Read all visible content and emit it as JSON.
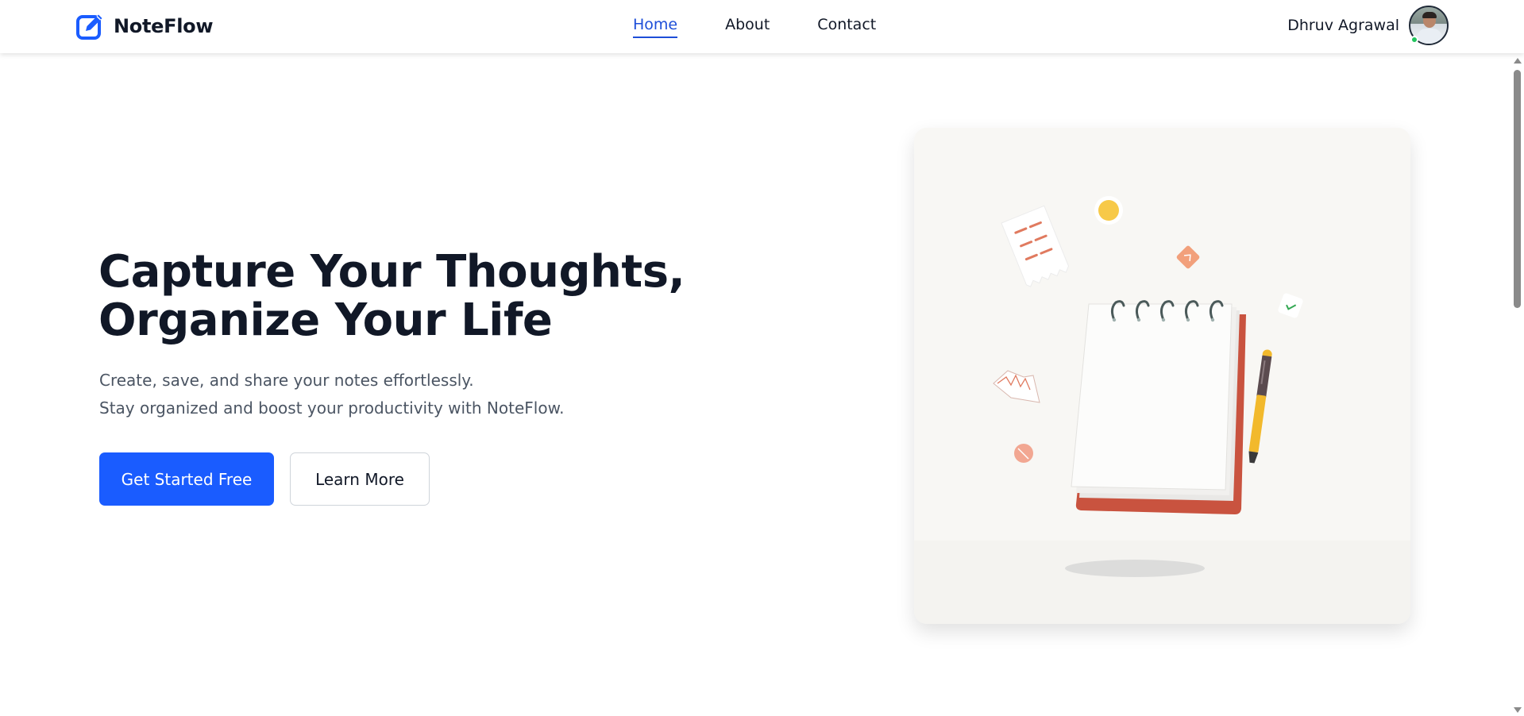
{
  "brand": {
    "name": "NoteFlow",
    "icon": "edit-note-icon"
  },
  "nav": {
    "links": [
      {
        "label": "Home",
        "active": true
      },
      {
        "label": "About",
        "active": false
      },
      {
        "label": "Contact",
        "active": false
      }
    ]
  },
  "user": {
    "name": "Dhruv Agrawal",
    "status": "online"
  },
  "hero": {
    "title_line1": "Capture Your Thoughts,",
    "title_line2": "Organize Your Life",
    "subtitle_line1": "Create, save, and share your notes effortlessly.",
    "subtitle_line2": "Stay organized and boost your productivity with NoteFlow.",
    "primary_cta": "Get Started Free",
    "secondary_cta": "Learn More"
  },
  "colors": {
    "accent": "#1a5cff",
    "active_link": "#1d4ed8",
    "heading": "#111827",
    "body_text": "#4b5563",
    "notebook_cover": "#c9533f",
    "pen": "#f2b92c",
    "online": "#22c55e"
  }
}
